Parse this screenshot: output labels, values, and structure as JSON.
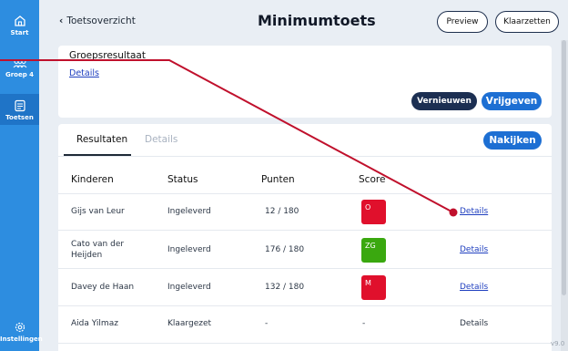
{
  "sidebar": {
    "items": [
      {
        "label": "Start",
        "icon": "home-icon"
      },
      {
        "label": "Groep 4",
        "icon": "group-icon"
      },
      {
        "label": "Toetsen",
        "icon": "tests-icon"
      },
      {
        "label": "Instellingen",
        "icon": "gear-icon"
      }
    ]
  },
  "header": {
    "back_label": "Toetsoverzicht",
    "title": "Minimumtoets",
    "preview_label": "Preview",
    "klaarzetten_label": "Klaarzetten"
  },
  "group_result": {
    "heading": "Groepsresultaat",
    "details_link": "Details",
    "refresh_label": "Vernieuwen",
    "release_label": "Vrijgeven"
  },
  "results": {
    "tabs": [
      {
        "label": "Resultaten",
        "active": true
      },
      {
        "label": "Details",
        "active": false
      }
    ],
    "check_label": "Nakijken",
    "columns": [
      "Kinderen",
      "Status",
      "Punten",
      "Score"
    ],
    "rows": [
      {
        "name": "Gijs van Leur",
        "status": "Ingeleverd",
        "points": "12 / 180",
        "score": "O",
        "score_color": "#e0102c",
        "details": "Details",
        "details_link": true
      },
      {
        "name": "Cato van der Heijden",
        "status": "Ingeleverd",
        "points": "176 / 180",
        "score": "ZG",
        "score_color": "#3aa80f",
        "details": "Details",
        "details_link": true
      },
      {
        "name": "Davey de Haan",
        "status": "Ingeleverd",
        "points": "132 / 180",
        "score": "M",
        "score_color": "#e0102c",
        "details": "Details",
        "details_link": true
      },
      {
        "name": "Aida Yilmaz",
        "status": "Klaargezet",
        "points": "-",
        "score": "-",
        "score_color": "",
        "details": "Details",
        "details_link": false
      }
    ]
  },
  "version": "v9.0",
  "colors": {
    "sidebar": "#2d8de0",
    "primary_dark": "#1c2f52",
    "primary_blue": "#1d6fd3",
    "annotation_line": "#c0102c"
  }
}
